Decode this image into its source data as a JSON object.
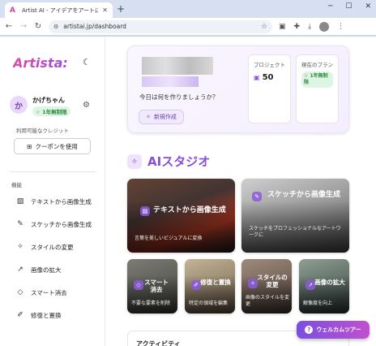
{
  "browser": {
    "tab_title": "Artist AI - アイデアをアートに変換",
    "new_tab": "+",
    "url": "artistai.jp/dashboard"
  },
  "sidebar": {
    "logo": "Artista:",
    "user": {
      "initial": "か",
      "name": "かげちゃん",
      "badge": "1年無制限"
    },
    "credits_label": "利用可能なクレジット",
    "coupon_label": "クーポンを使用",
    "section_label": "機能",
    "items": [
      {
        "label": "テキストから画像生成",
        "icon": "image-icon"
      },
      {
        "label": "スケッチから画像生成",
        "icon": "pencil-icon"
      },
      {
        "label": "スタイルの変更",
        "icon": "magic-wand-icon"
      },
      {
        "label": "画像の拡大",
        "icon": "expand-arrow-icon"
      },
      {
        "label": "スマート消去",
        "icon": "eraser-icon"
      },
      {
        "label": "修復と置換",
        "icon": "brush-icon"
      }
    ]
  },
  "welcome": {
    "greeting": "今日は何を作りましょうか？",
    "new_button": "新規作成",
    "stats": {
      "projects_label": "プロジェクト",
      "projects_value": "50",
      "plan_label": "現在のプラン",
      "plan_badge": "1年無制限"
    }
  },
  "studio": {
    "title": "AIスタジオ",
    "cards_large": [
      {
        "title": "テキストから画像生成",
        "desc": "言葉を美しいビジュアルに変換"
      },
      {
        "title": "スケッチから画像生成",
        "desc": "スケッチをプロフェッショナルなアートワークに"
      }
    ],
    "cards_small": [
      {
        "title": "スマート消去",
        "desc": "不要な要素を削除"
      },
      {
        "title": "修復と置換",
        "desc": "特定の領域を編集"
      },
      {
        "title": "スタイルの変更",
        "desc": "画像のスタイルを変更"
      },
      {
        "title": "画像の拡大",
        "desc": "解像度を向上"
      }
    ]
  },
  "activity": {
    "title": "アクティビティ"
  },
  "tour_button": "ウェルカムツアー",
  "colors": {
    "accent": "#8b4fd6",
    "badge_bg": "#dff5e3",
    "badge_text": "#2e8b44"
  }
}
